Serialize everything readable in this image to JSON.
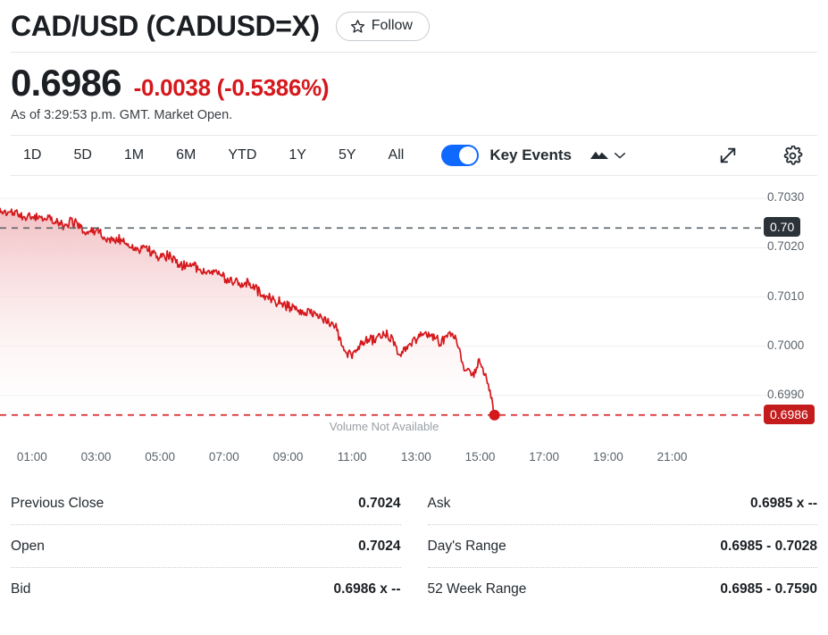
{
  "header": {
    "title": "CAD/USD (CADUSD=X)",
    "follow_label": "Follow",
    "follow_icon": "star-outline-icon"
  },
  "quote": {
    "price": "0.6986",
    "change": "-0.0038 (-0.5386%)",
    "as_of": "As of 3:29:53 p.m. GMT. Market Open.",
    "change_color": "#d5181c"
  },
  "toolbar": {
    "ranges": [
      "1D",
      "5D",
      "1M",
      "6M",
      "YTD",
      "1Y",
      "5Y",
      "All"
    ],
    "selected_range": "1D",
    "key_events_label": "Key Events",
    "key_events_on": true,
    "toggle_color": "#0f69ff",
    "chart_type_icon": "mountain-chart-icon",
    "chart_type_chevron_icon": "chevron-down-icon",
    "expand_icon": "expand-diagonal-icon",
    "settings_icon": "gear-icon"
  },
  "chart_data": {
    "type": "line",
    "title": "",
    "xlabel": "",
    "ylabel": "",
    "x_ticks": [
      "01:00",
      "03:00",
      "05:00",
      "07:00",
      "09:00",
      "11:00",
      "13:00",
      "15:00",
      "17:00",
      "19:00",
      "21:00"
    ],
    "y_ticks": [
      "0.7030",
      "0.7020",
      "0.7010",
      "0.7000",
      "0.6990"
    ],
    "y_tick_values": [
      0.703,
      0.702,
      0.701,
      0.7,
      0.699
    ],
    "ylim": [
      0.69845,
      0.70335
    ],
    "xlim": [
      0,
      24
    ],
    "grid": true,
    "legend": "none",
    "line_color": "#d5181c",
    "fill_gradient": [
      "#f7cfd1",
      "#ffffff"
    ],
    "previous_close_line": {
      "value": 0.7024,
      "label": "0.70",
      "style": "dashed",
      "color": "#5b636a"
    },
    "current_price_line": {
      "value": 0.6986,
      "label": "0.6986",
      "style": "dashed",
      "color": "#d5181c"
    },
    "end_marker": {
      "x_hour": 15.45,
      "value": 0.6986
    },
    "volume_note": "Volume Not Available",
    "series": [
      {
        "name": "CADUSD=X",
        "x": [
          0.0,
          0.25,
          0.5,
          0.75,
          1.0,
          1.25,
          1.5,
          1.75,
          2.0,
          2.25,
          2.5,
          2.75,
          3.0,
          3.25,
          3.5,
          3.75,
          4.0,
          4.25,
          4.5,
          4.75,
          5.0,
          5.25,
          5.5,
          5.75,
          6.0,
          6.25,
          6.5,
          6.75,
          7.0,
          7.25,
          7.5,
          7.75,
          8.0,
          8.25,
          8.5,
          8.75,
          9.0,
          9.25,
          9.5,
          9.75,
          10.0,
          10.25,
          10.5,
          10.75,
          11.0,
          11.25,
          11.5,
          11.75,
          12.0,
          12.25,
          12.5,
          12.75,
          13.0,
          13.25,
          13.5,
          13.75,
          14.0,
          14.25,
          14.5,
          14.75,
          15.0,
          15.2,
          15.45
        ],
        "values": [
          0.70276,
          0.70268,
          0.70272,
          0.70262,
          0.70268,
          0.70258,
          0.70262,
          0.70252,
          0.70248,
          0.70254,
          0.7024,
          0.70232,
          0.70236,
          0.70222,
          0.70214,
          0.70218,
          0.70206,
          0.70198,
          0.70202,
          0.70188,
          0.7018,
          0.70186,
          0.70172,
          0.70164,
          0.7017,
          0.70156,
          0.70148,
          0.70154,
          0.7014,
          0.70132,
          0.70124,
          0.7013,
          0.70116,
          0.70104,
          0.70096,
          0.7009,
          0.70082,
          0.70074,
          0.70068,
          0.70072,
          0.70058,
          0.70046,
          0.70038,
          0.69992,
          0.69982,
          0.70004,
          0.70016,
          0.7001,
          0.70024,
          0.70018,
          0.69976,
          0.70002,
          0.70014,
          0.70026,
          0.70018,
          0.70008,
          0.70022,
          0.70016,
          0.69958,
          0.69944,
          0.69966,
          0.69938,
          0.6986
        ]
      }
    ]
  },
  "stats": {
    "left": [
      {
        "label": "Previous Close",
        "value": "0.7024"
      },
      {
        "label": "Open",
        "value": "0.7024"
      },
      {
        "label": "Bid",
        "value": "0.6986 x --"
      }
    ],
    "right": [
      {
        "label": "Ask",
        "value": "0.6985 x --"
      },
      {
        "label": "Day's Range",
        "value": "0.6985 - 0.7028"
      },
      {
        "label": "52 Week Range",
        "value": "0.6985 - 0.7590"
      }
    ]
  }
}
